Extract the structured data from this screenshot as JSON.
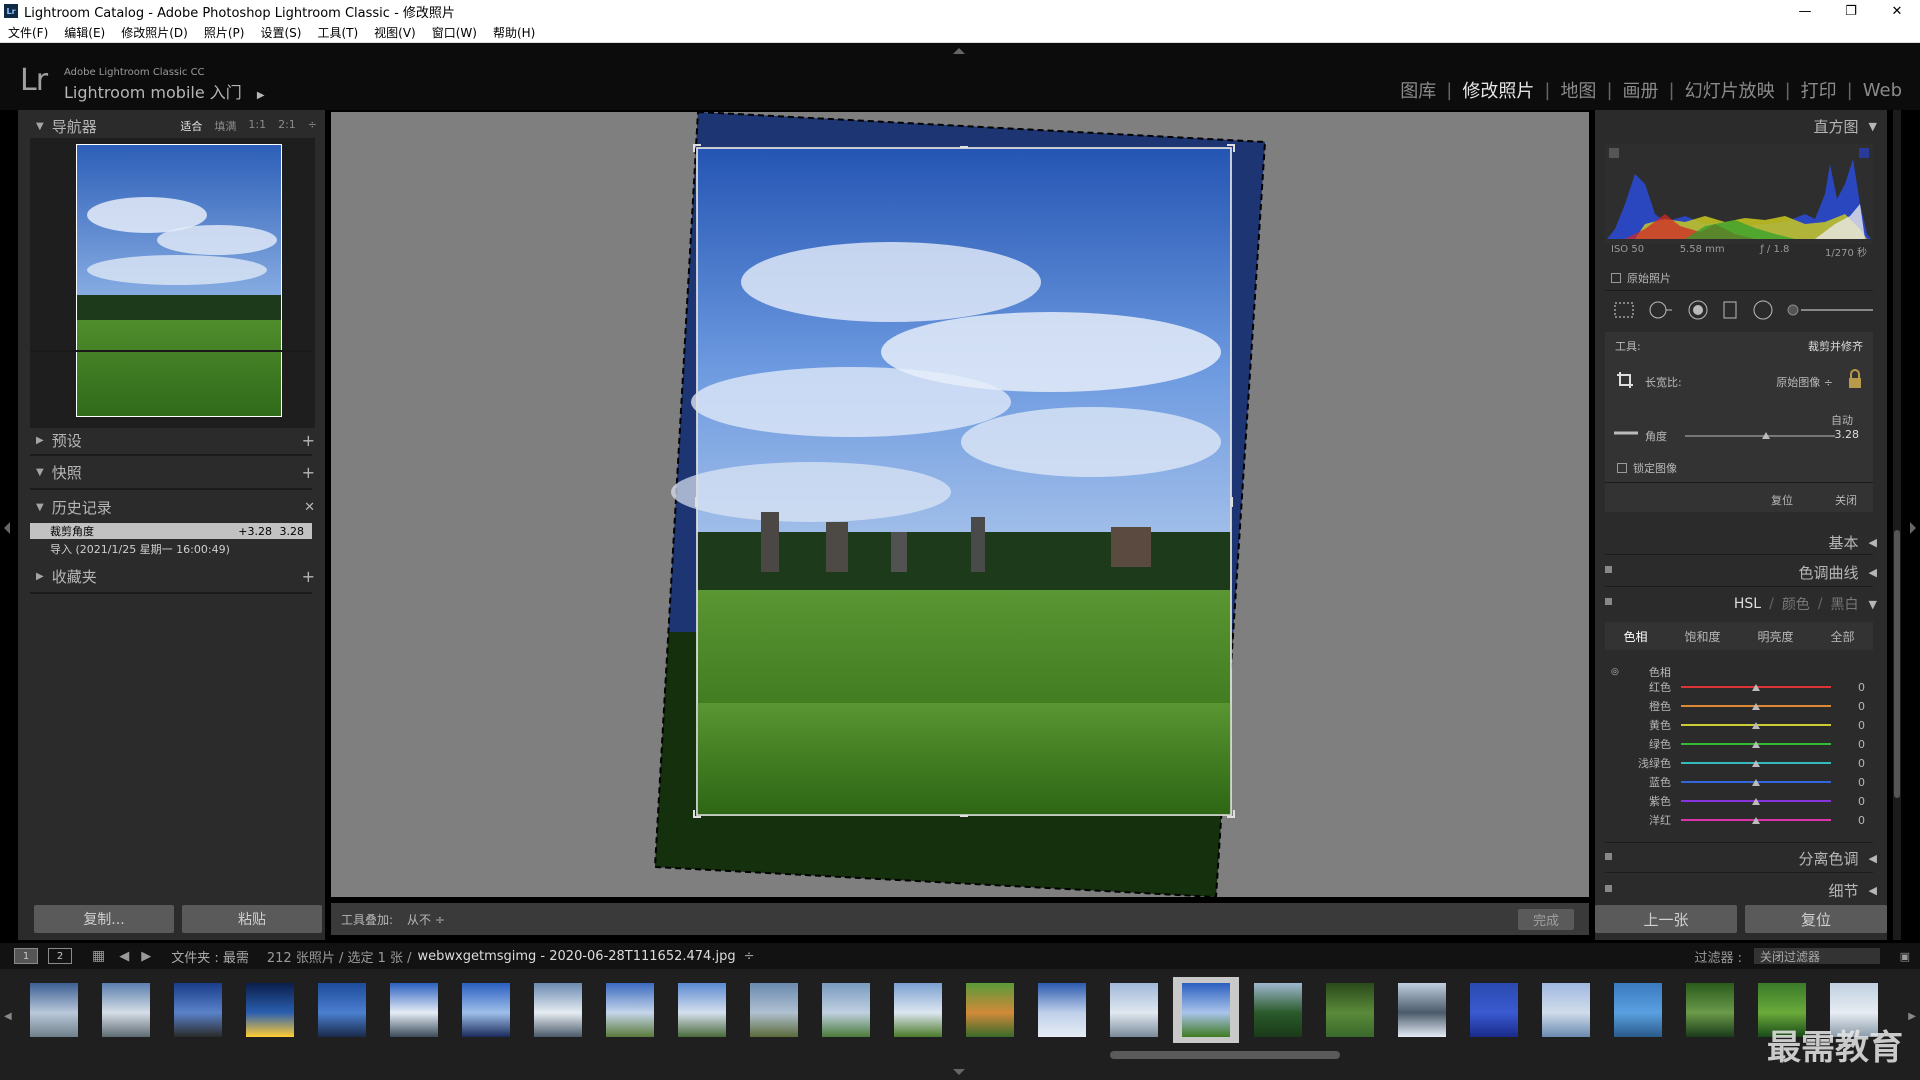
{
  "window": {
    "title": "Lightroom Catalog - Adobe Photoshop Lightroom Classic - 修改照片",
    "app_icon": "Lr",
    "minimize": "—",
    "restore": "❐",
    "close": "✕"
  },
  "menu": [
    "文件(F)",
    "编辑(E)",
    "修改照片(D)",
    "照片(P)",
    "设置(S)",
    "工具(T)",
    "视图(V)",
    "窗口(W)",
    "帮助(H)"
  ],
  "identity": {
    "logo": "Lr",
    "product_line": "Adobe Lightroom Classic CC",
    "mobile_text": "Lightroom mobile 入门",
    "mobile_arrow": "▶"
  },
  "modules": [
    "图库",
    "修改照片",
    "地图",
    "画册",
    "幻灯片放映",
    "打印",
    "Web"
  ],
  "active_module": "修改照片",
  "left": {
    "navigator": {
      "title": "导航器",
      "zoom": [
        "适合",
        "填满",
        "1:1",
        "2:1"
      ],
      "zoom_selected": "适合",
      "zoom_menu": "÷"
    },
    "presets": {
      "title": "预设",
      "action": "+"
    },
    "snapshots": {
      "title": "快照",
      "action": "+"
    },
    "history": {
      "title": "历史记录",
      "action": "✕",
      "items": [
        {
          "label": "裁剪角度",
          "delta": "+3.28",
          "value": "3.28"
        },
        {
          "label": "导入 (2021/1/25 星期一 16:00:49)",
          "delta": "",
          "value": ""
        }
      ]
    },
    "collections": {
      "title": "收藏夹",
      "action": "+"
    },
    "copy_button": "复制...",
    "paste_button": "粘贴"
  },
  "toolbar": {
    "overlay_label": "工具叠加:",
    "overlay_value": "从不 ÷",
    "done": "完成"
  },
  "right": {
    "histogram": {
      "title": "直方图",
      "iso": "ISO 50",
      "focal": "5.58 mm",
      "aperture": "ƒ / 1.8",
      "shutter": "1/270 秒",
      "original": "原始照片"
    },
    "crop": {
      "tool_label": "工具:",
      "tool_name": "裁剪并修齐",
      "aspect_label": "长宽比:",
      "aspect_value": "原始图像 ÷",
      "auto": "自动",
      "angle_label": "角度",
      "angle_value": "3.28",
      "angle_fraction": 0.54,
      "constrain": "锁定图像",
      "reset": "复位",
      "close": "关闭"
    },
    "panels": {
      "basic": "基本",
      "tone_curve": "色调曲线",
      "hsl": "HSL",
      "color": "颜色",
      "bw": "黑白",
      "split_toning": "分离色调",
      "detail": "细节"
    },
    "hsl_tabs": [
      "色相",
      "饱和度",
      "明亮度",
      "全部"
    ],
    "hsl_active": "色相",
    "hsl_group": "色相",
    "hsl_rows": [
      {
        "label": "红色",
        "value": "0",
        "color": "#d33"
      },
      {
        "label": "橙色",
        "value": "0",
        "color": "#d83"
      },
      {
        "label": "黄色",
        "value": "0",
        "color": "#cc3"
      },
      {
        "label": "绿色",
        "value": "0",
        "color": "#3b3"
      },
      {
        "label": "浅绿色",
        "value": "0",
        "color": "#3bb"
      },
      {
        "label": "蓝色",
        "value": "0",
        "color": "#36d"
      },
      {
        "label": "紫色",
        "value": "0",
        "color": "#83d"
      },
      {
        "label": "洋红",
        "value": "0",
        "color": "#d3a"
      }
    ],
    "prev_button": "上一张",
    "reset_button": "复位"
  },
  "filmbar": {
    "page1": "1",
    "page2": "2",
    "source": "文件夹 : 最需",
    "count": "212 张照片 / 选定 1 张 /",
    "filename": "webwxgetmsgimg - 2020-06-28T111652.474.jpg",
    "filename_arrow": "÷",
    "filter_label": "过滤器 :",
    "filter_value": "关闭过滤器"
  },
  "watermark": "最需教育",
  "colors": {
    "panel_bg": "#2b2b2b",
    "canvas_bg": "#7f7f7f",
    "sky_top": "#2d5fb8",
    "grass": "#3f7a22"
  }
}
